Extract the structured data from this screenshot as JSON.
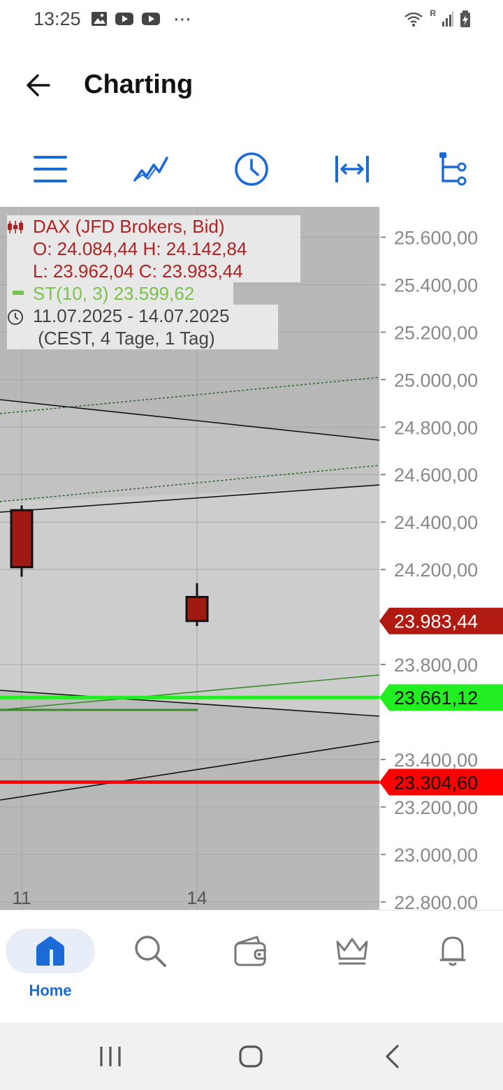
{
  "status_bar": {
    "time": "13:25",
    "more": "⋯",
    "icons_left": [
      "gallery-icon",
      "youtube-icon",
      "youtube-icon"
    ],
    "icons_right": [
      "wifi-icon",
      "signal-icon",
      "battery-charging-icon"
    ],
    "roaming_label": "R"
  },
  "app_bar": {
    "title": "Charting",
    "back_icon": "arrow-left-icon"
  },
  "toolbar": {
    "buttons": [
      {
        "name": "menu-icon"
      },
      {
        "name": "line-chart-icon"
      },
      {
        "name": "clock-icon"
      },
      {
        "name": "fit-width-icon"
      },
      {
        "name": "tree-icon"
      }
    ],
    "accent": "#1a6ad8"
  },
  "chart": {
    "legend": {
      "instrument": "DAX (JFD Brokers, Bid)",
      "ohlc_line1": "O: 24.084,44  H: 24.142,84",
      "ohlc_line2": "L: 23.962,04  C: 23.983,44",
      "indicator": "ST(10, 3) 23.599,62",
      "range_line1": "11.07.2025 - 14.07.2025",
      "range_line2": " (CEST, 4 Tage, 1 Tag)"
    },
    "colors": {
      "candle": "#9e1a12",
      "price_tag_current": "#b01a10",
      "level_green": "#22ee22",
      "level_red": "#ff0000",
      "supertrend": "#3b8a2a",
      "axis_text": "#888888"
    }
  },
  "chart_data": {
    "type": "candlestick",
    "x_ticks": [
      "11",
      "14"
    ],
    "y_ticks": [
      "25.600,00",
      "25.400,00",
      "25.200,00",
      "25.000,00",
      "24.800,00",
      "24.600,00",
      "24.400,00",
      "24.200,00",
      "23.800,00",
      "23.400,00",
      "23.200,00",
      "23.000,00",
      "22.800,00"
    ],
    "y_tick_values": [
      25600,
      25400,
      25200,
      25000,
      24800,
      24600,
      24400,
      24200,
      23800,
      23400,
      23200,
      23000,
      22800
    ],
    "ylim": [
      22767,
      25728
    ],
    "candles": [
      {
        "x": "11",
        "open": 24450,
        "high": 24470,
        "low": 24170,
        "close": 24210
      },
      {
        "x": "14",
        "open": 24084.44,
        "high": 24142.84,
        "low": 23962.04,
        "close": 23983.44
      }
    ],
    "price_labels": [
      {
        "text": "23.983,44",
        "value": 23983.44,
        "color": "#b01a10",
        "text_color": "#ffffff"
      },
      {
        "text": "23.661,12",
        "value": 23661.12,
        "color": "#22ee22",
        "text_color": "#111111"
      },
      {
        "text": "23.304,60",
        "value": 23304.6,
        "color": "#ff0000",
        "text_color": "#111111"
      }
    ],
    "horizontal_levels": [
      {
        "value": 23661.12,
        "color": "#22ee22"
      },
      {
        "value": 23304.6,
        "color": "#ff0000"
      }
    ]
  },
  "bottom_nav": {
    "items": [
      {
        "label": "Home",
        "icon": "home-icon"
      },
      {
        "label": "",
        "icon": "search-icon"
      },
      {
        "label": "",
        "icon": "wallet-icon"
      },
      {
        "label": "",
        "icon": "crown-icon"
      },
      {
        "label": "",
        "icon": "bell-icon"
      }
    ]
  },
  "system_nav": {
    "buttons": [
      "recents-icon",
      "home-circle-icon",
      "back-chevron-icon"
    ]
  }
}
